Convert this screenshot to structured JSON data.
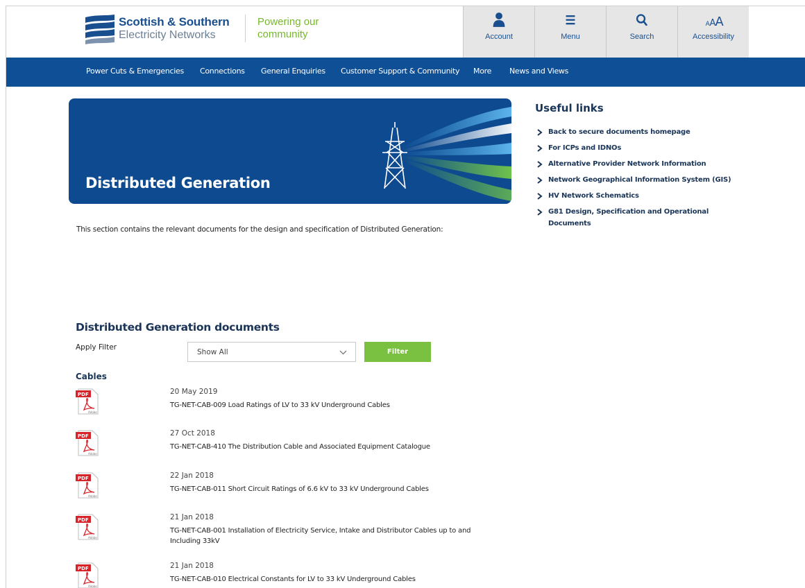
{
  "header": {
    "brand_line1": "Scottish & Southern",
    "brand_line2": "Electricity Networks",
    "tagline_line1": "Powering our",
    "tagline_line2": "community",
    "utility": [
      {
        "label": "Account",
        "icon": "user-icon"
      },
      {
        "label": "Menu",
        "icon": "menu-icon"
      },
      {
        "label": "Search",
        "icon": "search-icon"
      },
      {
        "label": "Accessibility",
        "icon": "text-size-icon",
        "glyph": "AAA"
      }
    ]
  },
  "nav": {
    "items": [
      "Power Cuts & Emergencies",
      "Connections",
      "General Enquiries",
      "Customer Support & Community",
      "More",
      "News and Views"
    ]
  },
  "banner": {
    "title": "Distributed Generation"
  },
  "intro": "This section contains the relevant documents for the design and specification of Distributed Generation:",
  "useful_links": {
    "title": "Useful links",
    "items": [
      "Back to secure documents homepage",
      "For ICPs and IDNOs",
      "Alternative Provider Network Information",
      "Network Geographical Information System (GIS)",
      "HV Network Schematics",
      "G81 Design, Specification and Operational Documents"
    ]
  },
  "documents": {
    "title": "Distributed Generation documents",
    "apply_filter_label": "Apply Filter",
    "filter_value": "Show All",
    "filter_button": "Filter",
    "category": "Cables",
    "pdf_badge": "PDF",
    "pdf_brand": "Adobe",
    "items": [
      {
        "date": "20 May 2019",
        "name": "TG-NET-CAB-009 Load Ratings of LV to 33 kV Underground Cables"
      },
      {
        "date": "27 Oct 2018",
        "name": "TG-NET-CAB-410 The Distribution Cable and Associated Equipment Catalogue"
      },
      {
        "date": "22 Jan 2018",
        "name": "TG-NET-CAB-011 Short Circuit Ratings of 6.6 kV to 33 kV Underground Cables"
      },
      {
        "date": "21 Jan 2018",
        "name": "TG-NET-CAB-001 Installation of Electricity Service, Intake and Distributor Cables up to and Including 33kV"
      },
      {
        "date": "21 Jan 2018",
        "name": "TG-NET-CAB-010 Electrical Constants for LV to 33 kV Underground Cables"
      }
    ]
  },
  "colors": {
    "brand_blue": "#0e4f96",
    "accent_green": "#7ac142",
    "heading_navy": "#1a3557",
    "pdf_red": "#d7242b"
  }
}
